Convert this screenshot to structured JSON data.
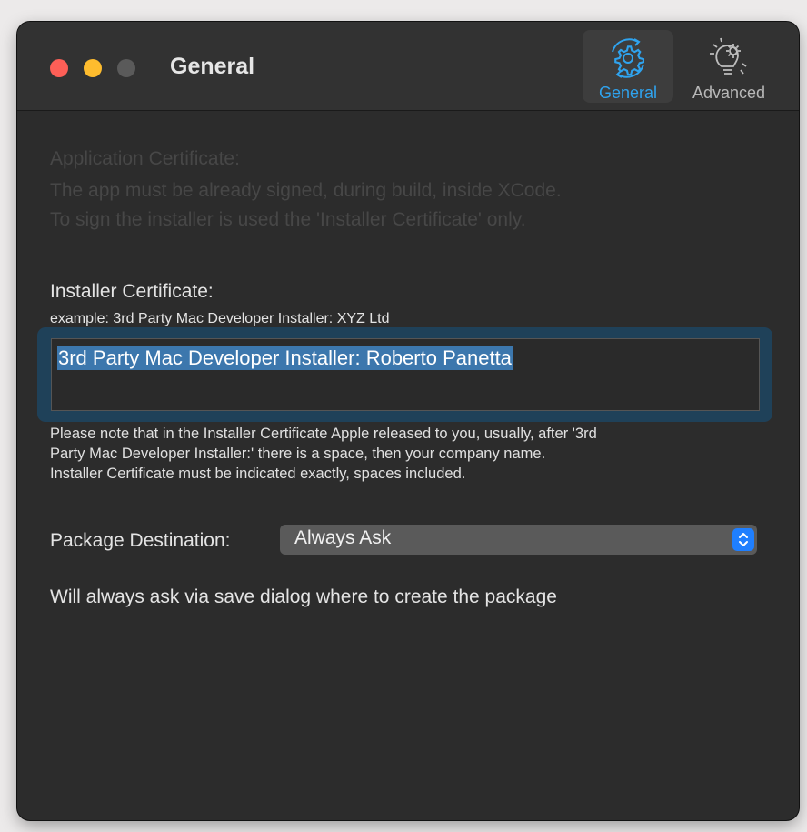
{
  "window": {
    "title": "General"
  },
  "toolbar": {
    "items": [
      {
        "label": "General",
        "icon": "gear-sync-icon",
        "selected": true
      },
      {
        "label": "Advanced",
        "icon": "lightbulb-gear-icon",
        "selected": false
      }
    ]
  },
  "app_certificate": {
    "heading": "Application Certificate:",
    "line1": "The app must be already signed, during build, inside XCode.",
    "line2": "To sign the installer is used the 'Installer Certificate' only."
  },
  "installer_certificate": {
    "heading": "Installer Certificate:",
    "example": "example: 3rd Party Mac Developer Installer: XYZ Ltd",
    "value": "3rd Party Mac Developer Installer: Roberto Panetta",
    "note_line1": "Please note that in the Installer Certificate Apple released to you, usually, after '3rd",
    "note_line2": "Party Mac Developer Installer:' there is a space, then your company name.",
    "note_line3": "Installer Certificate must be indicated exactly, spaces included."
  },
  "package_destination": {
    "label": "Package Destination:",
    "selected": "Always Ask",
    "description": "Will always ask via save dialog where to create the package"
  },
  "colors": {
    "accent": "#2fa3ee",
    "selection": "#3c77ad",
    "close": "#fe5f57",
    "minimize": "#febc2e"
  }
}
